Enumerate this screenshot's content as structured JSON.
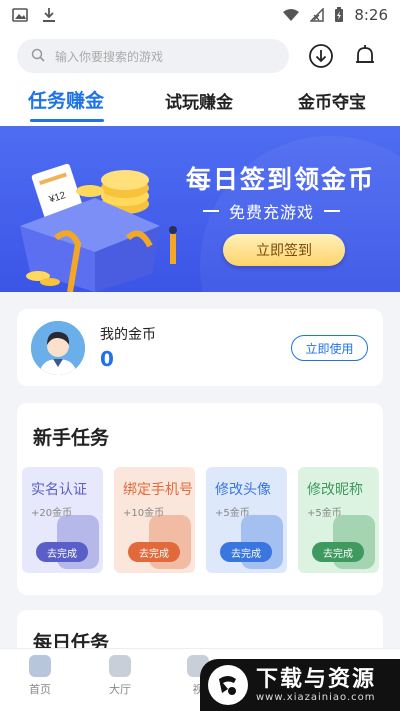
{
  "status_bar": {
    "time": "8:26"
  },
  "search": {
    "placeholder": "输入你要搜索的游戏"
  },
  "tabs": [
    {
      "label": "任务赚金"
    },
    {
      "label": "试玩赚金"
    },
    {
      "label": "金币夺宝"
    }
  ],
  "banner": {
    "title": "每日签到领金币",
    "subtitle": "免费充游戏",
    "button": "立即签到",
    "ticket_text": "¥12"
  },
  "coins": {
    "label": "我的金币",
    "value": "0",
    "button": "立即使用"
  },
  "newbie": {
    "title": "新手任务",
    "tasks": [
      {
        "name": "实名认证",
        "reward": "+20金币",
        "button": "去完成",
        "color": "#5a5fc7",
        "bg": "#e7e8fb"
      },
      {
        "name": "绑定手机号",
        "reward": "+10金币",
        "button": "去完成",
        "color": "#e06a3c",
        "bg": "#fbe6dc"
      },
      {
        "name": "修改头像",
        "reward": "+5金币",
        "button": "去完成",
        "color": "#3a76e0",
        "bg": "#dde8fb"
      },
      {
        "name": "修改昵称",
        "reward": "+5金币",
        "button": "去完成",
        "color": "#3f9a5f",
        "bg": "#dcf3e1"
      }
    ]
  },
  "daily": {
    "title": "每日任务"
  },
  "bottom_nav": [
    {
      "label": "首页"
    },
    {
      "label": "大厅"
    },
    {
      "label": "视"
    }
  ],
  "watermark": {
    "title": "下载与资源",
    "url": "www.xiazainiao.com"
  },
  "colors": {
    "accent": "#1e73e8",
    "banner": "#4a66ef"
  }
}
